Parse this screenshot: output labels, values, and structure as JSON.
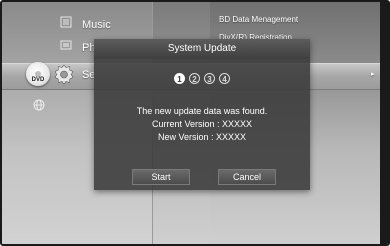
{
  "menu": {
    "items": [
      {
        "label": "Music",
        "icon": "music-icon"
      },
      {
        "label": "Ph",
        "icon": "photo-icon"
      },
      {
        "label": "Se",
        "icon": "settings-gear-icon"
      }
    ],
    "disc_label": "DVD",
    "network_icon": "globe-icon"
  },
  "submenu": {
    "items": [
      "BD Data Menagement",
      "DivX(R) Registration"
    ],
    "arrow": "▸"
  },
  "dialog": {
    "title": "System Update",
    "steps": [
      "1",
      "2",
      "3",
      "4"
    ],
    "active_step": 1,
    "message_line1": "The new update data was found.",
    "message_line2": "Current Version : XXXXX",
    "message_line3": "New Version : XXXXX",
    "start_label": "Start",
    "cancel_label": "Cancel"
  }
}
